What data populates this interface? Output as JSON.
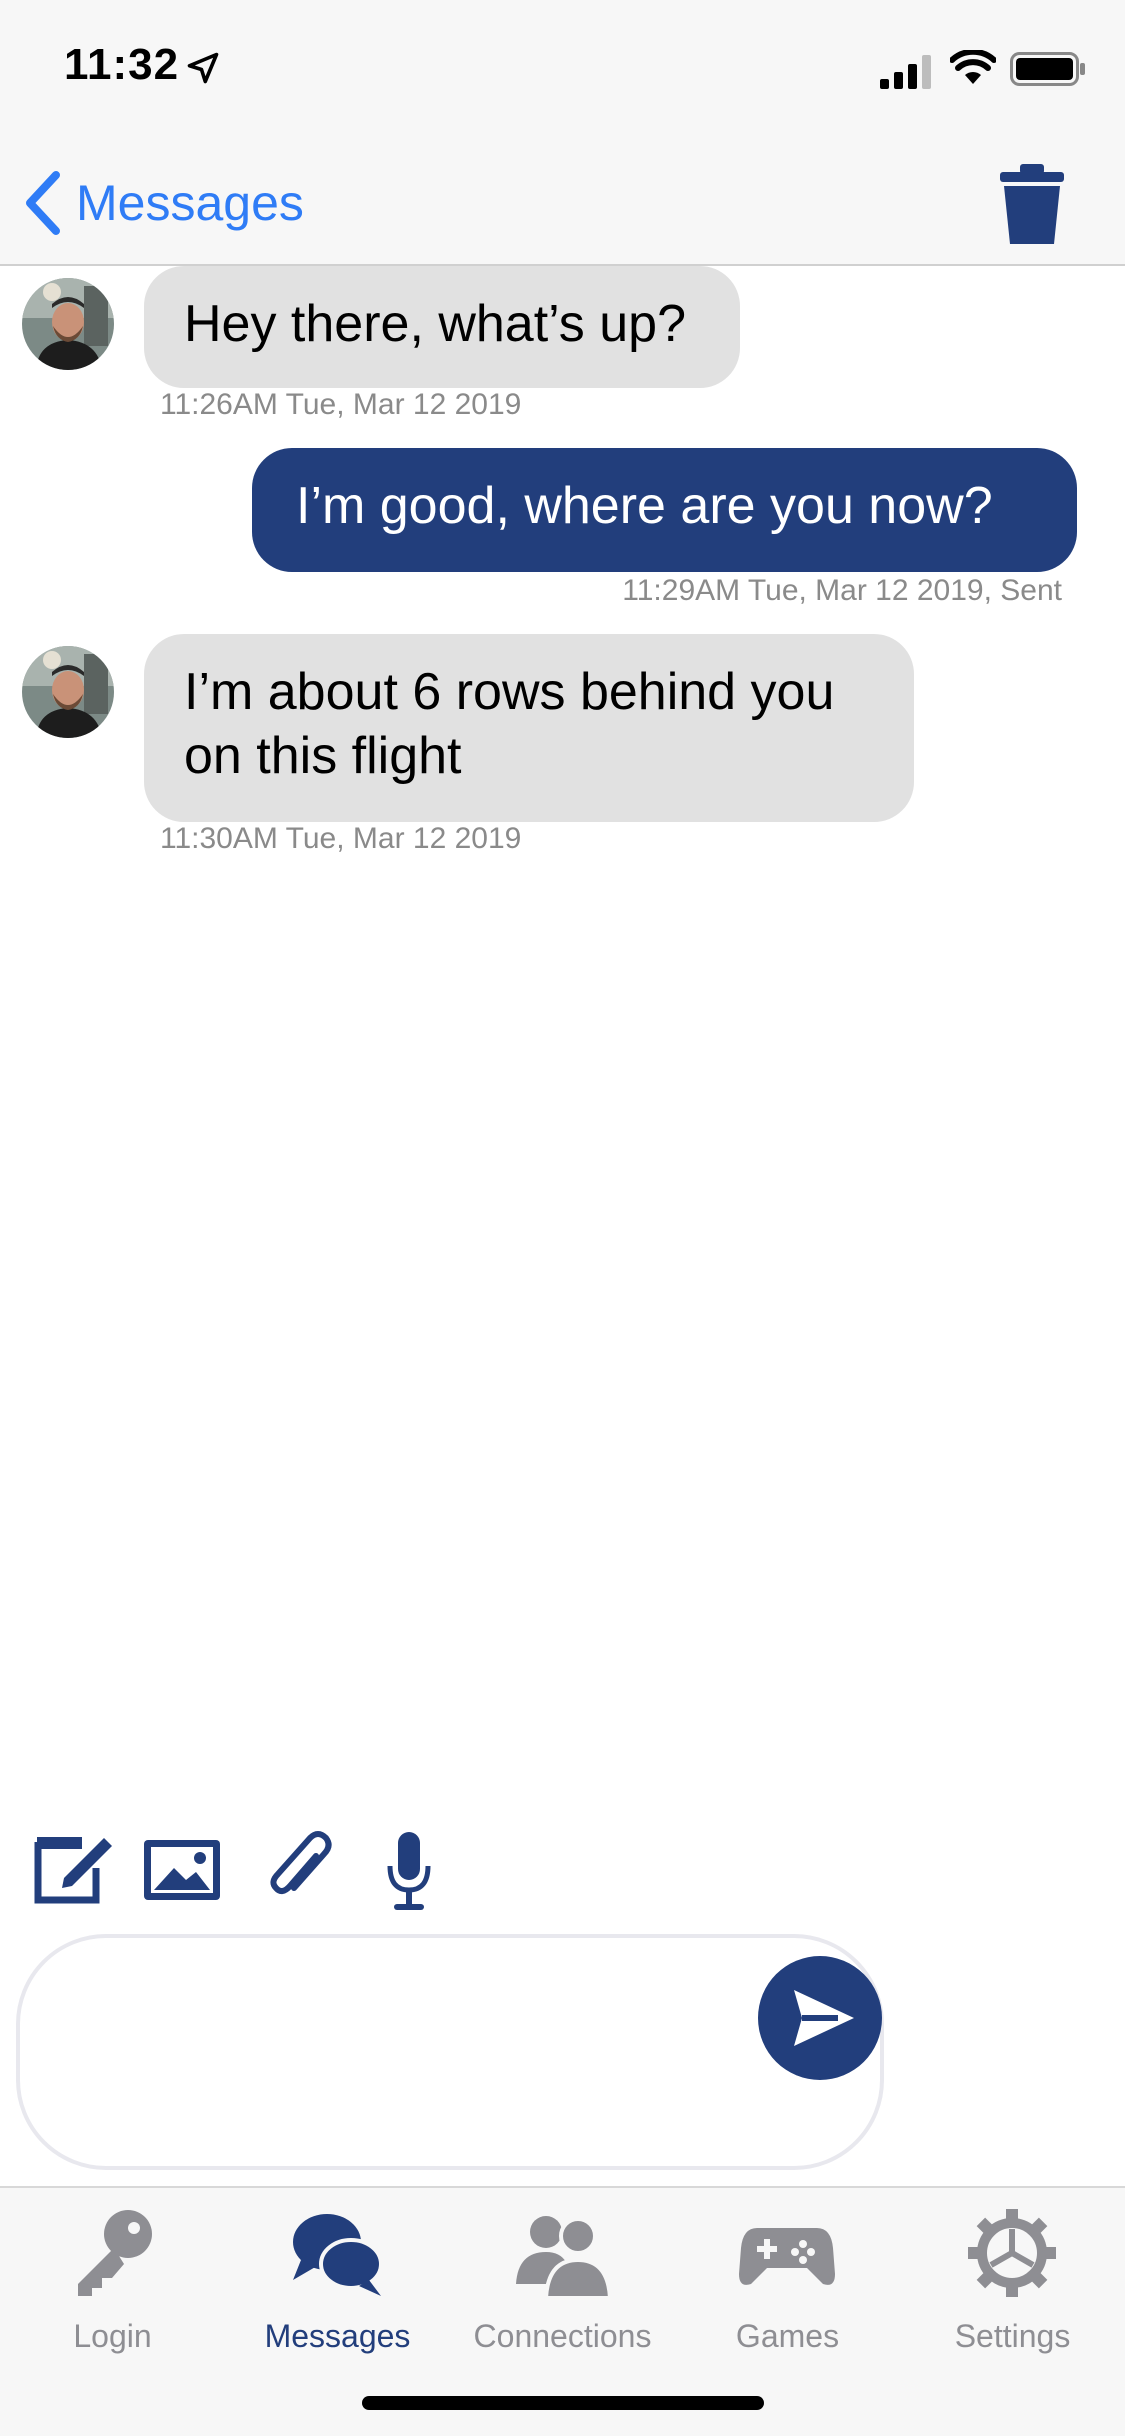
{
  "status_bar": {
    "time": "11:32"
  },
  "nav": {
    "back_label": "Messages"
  },
  "messages": [
    {
      "direction": "incoming",
      "text": "Hey there, what’s up?",
      "meta": "11:26AM Tue, Mar 12 2019"
    },
    {
      "direction": "outgoing",
      "text": "I’m good, where are you now?",
      "meta": "11:29AM Tue, Mar 12 2019, Sent"
    },
    {
      "direction": "incoming",
      "text": "I’m about 6 rows behind you on this flight",
      "meta": "11:30AM Tue, Mar 12 2019"
    }
  ],
  "composer": {
    "placeholder": ""
  },
  "tabs": [
    {
      "label": "Login",
      "icon": "key-icon",
      "active": false
    },
    {
      "label": "Messages",
      "icon": "chat-bubbles-icon",
      "active": true
    },
    {
      "label": "Connections",
      "icon": "people-icon",
      "active": false
    },
    {
      "label": "Games",
      "icon": "gamepad-icon",
      "active": false
    },
    {
      "label": "Settings",
      "icon": "gear-icon",
      "active": false
    }
  ],
  "colors": {
    "accent": "#223e7c",
    "link": "#2f7cf6",
    "incoming_bubble": "#e1e1e1",
    "inactive_tab": "#8e8e93"
  }
}
